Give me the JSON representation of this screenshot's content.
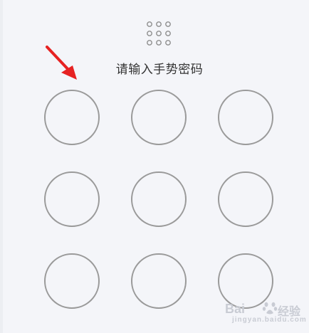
{
  "lock_screen": {
    "prompt": "请输入手势密码",
    "icon": "dot-grid-icon",
    "pattern_nodes": [
      1,
      2,
      3,
      4,
      5,
      6,
      7,
      8,
      9
    ]
  },
  "annotation": {
    "icon": "red-arrow-icon",
    "color": "#e62222"
  },
  "watermark": {
    "left_text": "Bai",
    "right_text": "经验",
    "sub_text": "jingyan.baidu.com"
  }
}
